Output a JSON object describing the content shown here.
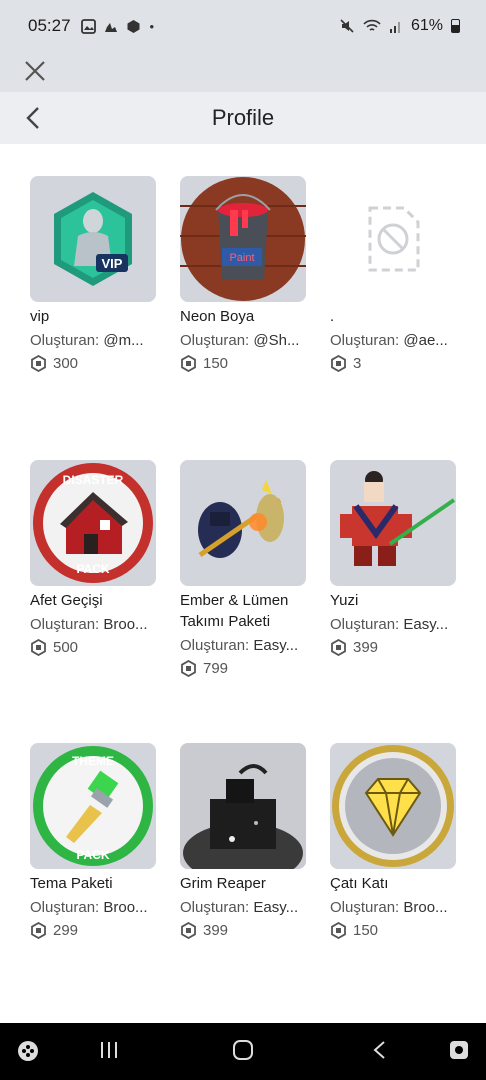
{
  "status": {
    "time": "05:27",
    "battery": "61%"
  },
  "header": {
    "title": "Profile"
  },
  "creator_prefix": "Oluşturan:",
  "items": [
    {
      "name": "vip",
      "creator": "@m...",
      "price": "300"
    },
    {
      "name": "Neon Boya",
      "creator": "@Sh...",
      "price": "150"
    },
    {
      "name": ".",
      "creator": "@ae...",
      "price": "3"
    },
    {
      "name": "Afet Geçişi",
      "creator": "Broo...",
      "price": "500"
    },
    {
      "name": "Ember & Lümen Takımı Paketi",
      "creator": "Easy...",
      "price": "799"
    },
    {
      "name": "Yuzi",
      "creator": "Easy...",
      "price": "399"
    },
    {
      "name": "Tema Paketi",
      "creator": "Broo...",
      "price": "299"
    },
    {
      "name": "Grim Reaper",
      "creator": "Easy...",
      "price": "399"
    },
    {
      "name": "Çatı Katı",
      "creator": "Broo...",
      "price": "150"
    }
  ],
  "thumb_text": {
    "vip_badge": "VIP",
    "paint_label": "Paint",
    "disaster_top": "DISASTER",
    "disaster_bottom": "PACK",
    "theme_top": "THEME",
    "theme_bottom": "PACK"
  },
  "colors": {
    "statusbar_bg": "#dfe2e6",
    "navbar_bg": "#eceef1",
    "thumb_bg": "#d3d5dc"
  }
}
